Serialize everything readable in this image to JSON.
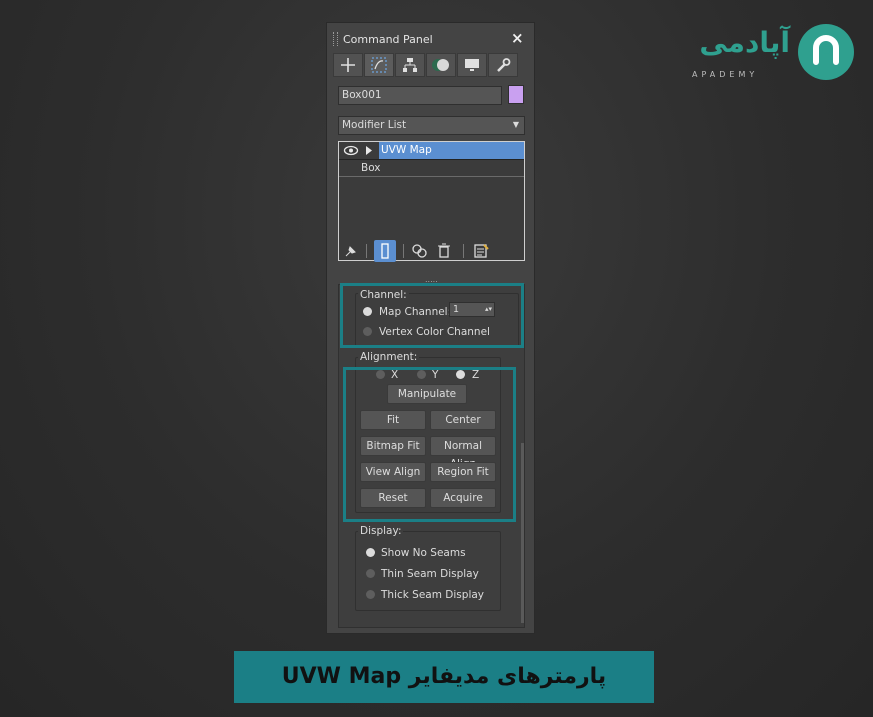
{
  "panel": {
    "title": "Command Panel",
    "close": "×",
    "tabs": [
      "create-icon",
      "modify-icon",
      "hierarchy-icon",
      "motion-icon",
      "display-icon",
      "utilities-icon"
    ],
    "object_name": "Box001",
    "object_color": "#c9a0f0",
    "modifier_list": "Modifier List",
    "dropdown_arrow": "▼",
    "stack": [
      {
        "label": "UVW Map",
        "selected": true
      },
      {
        "label": "Box",
        "selected": false
      }
    ],
    "resize_handle": "....."
  },
  "channel": {
    "title": "Channel:",
    "map_channel_label": "Map Channel:",
    "map_channel_value": "1",
    "spinner": "▴▾",
    "vertex_color_label": "Vertex Color Channel"
  },
  "alignment": {
    "title": "Alignment:",
    "axes": [
      {
        "label": "X",
        "selected": false
      },
      {
        "label": "Y",
        "selected": false
      },
      {
        "label": "Z",
        "selected": true
      }
    ],
    "manipulate": "Manipulate",
    "buttons": [
      "Fit",
      "Center",
      "Bitmap Fit",
      "Normal Align",
      "View Align",
      "Region Fit",
      "Reset",
      "Acquire"
    ]
  },
  "display": {
    "title": "Display:",
    "options": [
      {
        "label": "Show No Seams",
        "selected": true
      },
      {
        "label": "Thin Seam Display",
        "selected": false
      },
      {
        "label": "Thick Seam Display",
        "selected": false
      }
    ]
  },
  "brand": {
    "name_fa": "آپادمی",
    "name_en": "APADEMY",
    "logo_letter": "a",
    "accent": "#2fa08f"
  },
  "banner": {
    "text": "پارمترهای مدیفایر UVW Map",
    "color": "#1b7f86"
  }
}
